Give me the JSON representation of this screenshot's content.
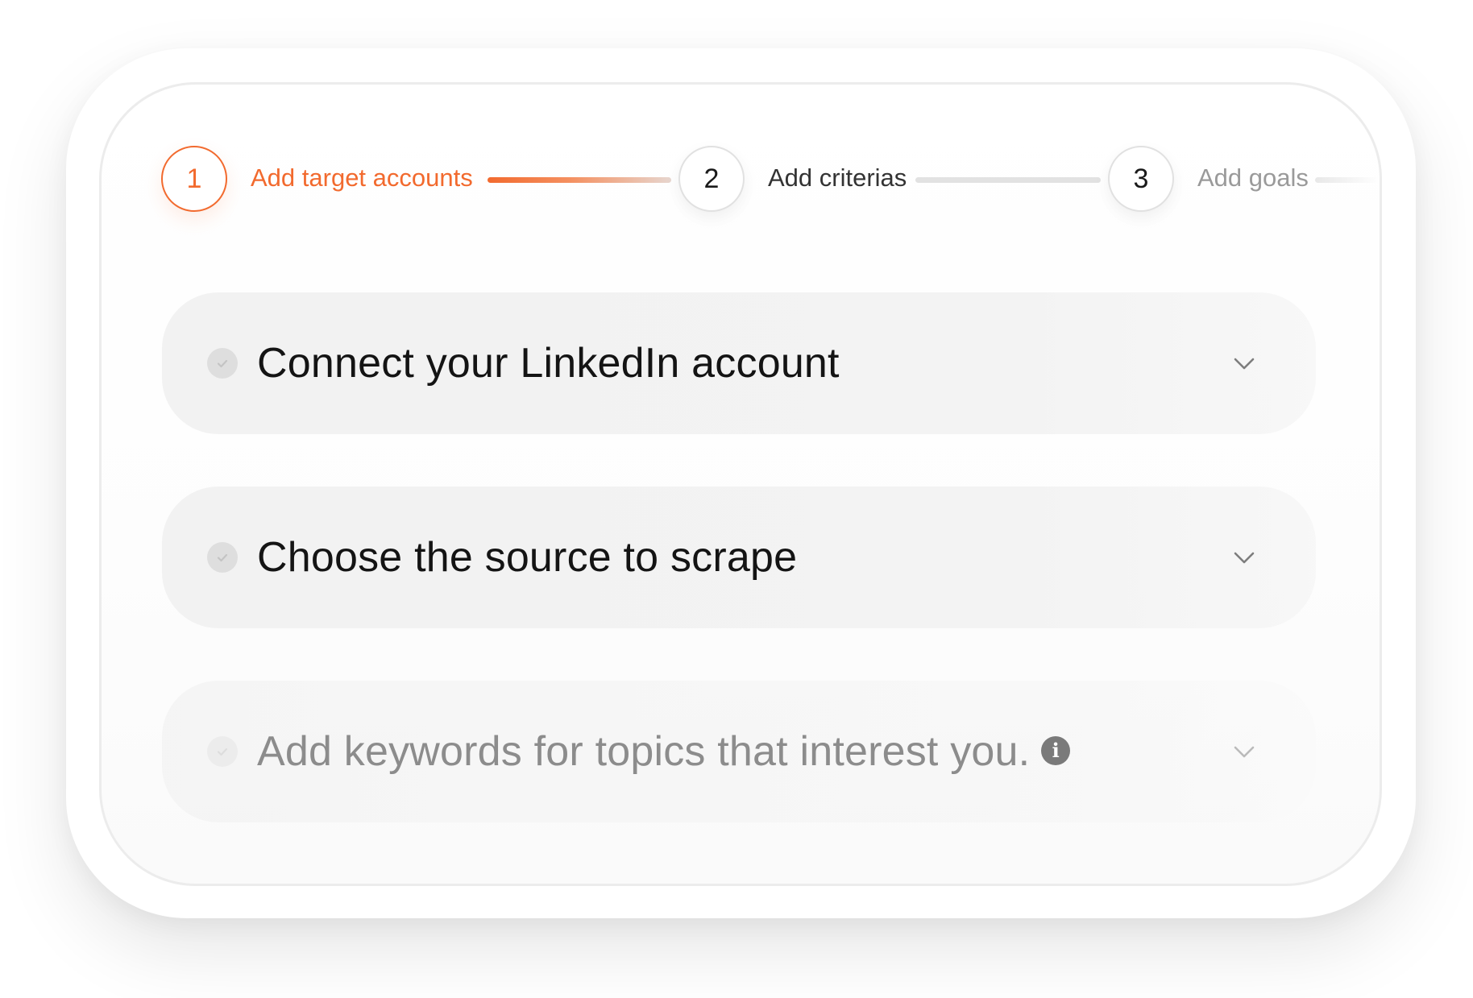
{
  "stepper": {
    "steps": [
      {
        "number": "1",
        "label": "Add target accounts",
        "state": "active"
      },
      {
        "number": "2",
        "label": "Add criterias",
        "state": "pending"
      },
      {
        "number": "3",
        "label": "Add goals",
        "state": "pending"
      }
    ]
  },
  "accordion": {
    "items": [
      {
        "title": "Connect your LinkedIn account",
        "icon": "check-icon",
        "expand_icon": "chevron-down-icon"
      },
      {
        "title": "Choose the source to scrape",
        "icon": "check-icon",
        "expand_icon": "chevron-down-icon"
      },
      {
        "title": "Add keywords for topics that interest you.",
        "icon": "check-icon",
        "info_icon": "i",
        "expand_icon": "chevron-down-icon"
      }
    ]
  },
  "colors": {
    "accent": "#f26a2e",
    "text": "#141414",
    "muted": "#9a9a9a",
    "row_bg": "#f2f2f2"
  }
}
